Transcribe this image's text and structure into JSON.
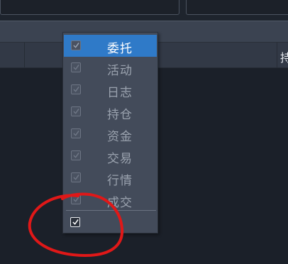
{
  "colors": {
    "background": "#1b2029",
    "toolbar": "#3b4351",
    "header": "#323946",
    "menu_bg": "#434b5a",
    "menu_selected": "#2f7ac8",
    "menu_text": "#9aa2ae",
    "menu_text_selected": "#ffffff",
    "annotation": "#e01818"
  },
  "header": {
    "partial_column": "持"
  },
  "menu": {
    "items": [
      {
        "label": "委托",
        "checked": true,
        "selected": true
      },
      {
        "label": "活动",
        "checked": true,
        "selected": false
      },
      {
        "label": "日志",
        "checked": true,
        "selected": false
      },
      {
        "label": "持仓",
        "checked": true,
        "selected": false
      },
      {
        "label": "资金",
        "checked": true,
        "selected": false
      },
      {
        "label": "交易",
        "checked": true,
        "selected": false
      },
      {
        "label": "行情",
        "checked": true,
        "selected": false
      },
      {
        "label": "成交",
        "checked": true,
        "selected": false
      }
    ],
    "bottom_checkbox": {
      "checked": true
    }
  },
  "icons": {
    "check": "check-icon"
  }
}
